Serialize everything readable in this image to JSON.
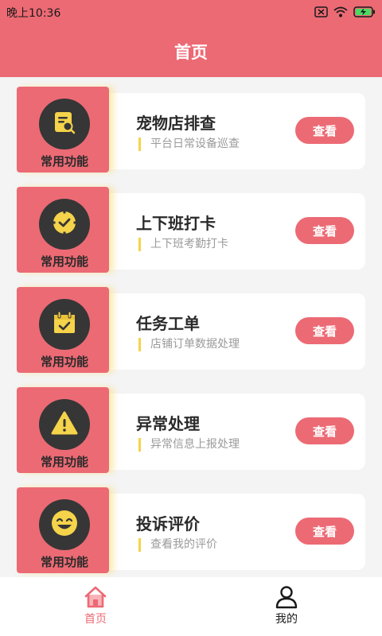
{
  "status_bar": {
    "time": "晚上10:36"
  },
  "header": {
    "title": "首页"
  },
  "cards": [
    {
      "badge_label": "常用功能",
      "title": "宠物店排查",
      "subtitle": "平台日常设备巡查",
      "button_label": "查看",
      "icon": "inspection-document-icon"
    },
    {
      "badge_label": "常用功能",
      "title": "上下班打卡",
      "subtitle": "上下班考勤打卡",
      "button_label": "查看",
      "icon": "clock-check-icon"
    },
    {
      "badge_label": "常用功能",
      "title": "任务工单",
      "subtitle": "店铺订单数据处理",
      "button_label": "查看",
      "icon": "calendar-check-icon"
    },
    {
      "badge_label": "常用功能",
      "title": "异常处理",
      "subtitle": "异常信息上报处理",
      "button_label": "查看",
      "icon": "warning-icon"
    },
    {
      "badge_label": "常用功能",
      "title": "投诉评价",
      "subtitle": "查看我的评价",
      "button_label": "查看",
      "icon": "smile-icon"
    }
  ],
  "tabbar": {
    "items": [
      {
        "label": "首页",
        "icon": "home-icon",
        "active": true
      },
      {
        "label": "我的",
        "icon": "user-icon",
        "active": false
      }
    ]
  },
  "colors": {
    "primary": "#ec6a74",
    "accent_yellow": "#f5d34a",
    "icon_circle": "#363636"
  }
}
